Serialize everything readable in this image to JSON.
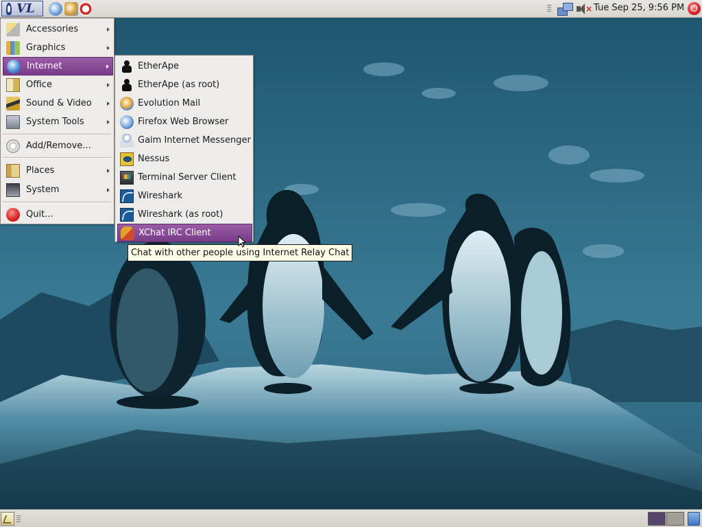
{
  "top_panel": {
    "logo_text": "VL",
    "launchers": [
      "firefox-launcher-icon",
      "evolution-launcher-icon",
      "help-launcher-icon"
    ],
    "clock": "Tue Sep 25,  9:56 PM"
  },
  "main_menu": {
    "items": [
      {
        "label": "Accessories",
        "icon": "accessories-icon",
        "submenu": true
      },
      {
        "label": "Graphics",
        "icon": "graphics-icon",
        "submenu": true
      },
      {
        "label": "Internet",
        "icon": "internet-icon",
        "submenu": true,
        "active": true
      },
      {
        "label": "Office",
        "icon": "office-icon",
        "submenu": true
      },
      {
        "label": "Sound & Video",
        "icon": "sound-video-icon",
        "submenu": true
      },
      {
        "label": "System Tools",
        "icon": "system-tools-icon",
        "submenu": true
      },
      {
        "label": "Add/Remove...",
        "icon": "add-remove-icon",
        "submenu": false
      },
      {
        "label": "Places",
        "icon": "places-icon",
        "submenu": true
      },
      {
        "label": "System",
        "icon": "system-icon",
        "submenu": true
      },
      {
        "label": "Quit...",
        "icon": "quit-icon",
        "submenu": false
      }
    ]
  },
  "internet_submenu": {
    "items": [
      {
        "label": "EtherApe",
        "icon": "etherape-icon"
      },
      {
        "label": "EtherApe (as root)",
        "icon": "etherape-icon"
      },
      {
        "label": "Evolution Mail",
        "icon": "evolution-icon"
      },
      {
        "label": "Firefox Web Browser",
        "icon": "firefox-icon"
      },
      {
        "label": "Gaim Internet Messenger",
        "icon": "gaim-icon"
      },
      {
        "label": "Nessus",
        "icon": "nessus-icon"
      },
      {
        "label": "Terminal Server Client",
        "icon": "tsclient-icon"
      },
      {
        "label": "Wireshark",
        "icon": "wireshark-icon"
      },
      {
        "label": "Wireshark (as root)",
        "icon": "wireshark-icon"
      },
      {
        "label": "XChat IRC Client",
        "icon": "xchat-icon",
        "active": true
      }
    ]
  },
  "tooltip": {
    "text": "Chat with other people using Internet Relay Chat"
  },
  "colors": {
    "highlight": "#8a4a99",
    "panel": "#dfddd8",
    "wallpaper": "#2e6279"
  }
}
